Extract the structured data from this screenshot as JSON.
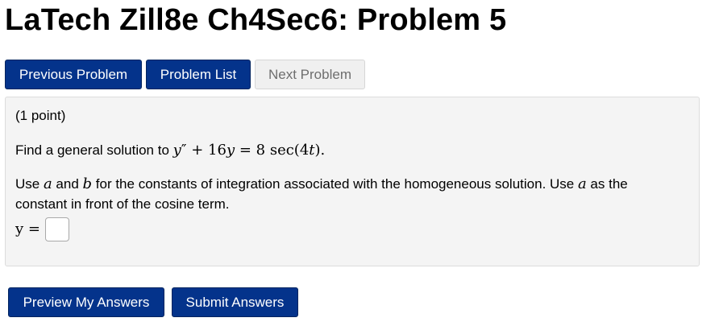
{
  "page_title": "LaTech Zill8e Ch4Sec6: Problem 5",
  "nav": {
    "previous_label": "Previous Problem",
    "list_label": "Problem List",
    "next_label": "Next Problem"
  },
  "problem": {
    "points": "(1 point)",
    "statement_prefix": "Find a general solution to ",
    "equation": {
      "y": "y",
      "prime": "″",
      "plus": " + 16",
      "y2": "y",
      "equals": " = 8 sec(4",
      "t": "t",
      "close": ")."
    },
    "instruction": {
      "part1": "Use ",
      "a": "a",
      "part2": " and ",
      "b": "b",
      "part3": " for the constants of integration associated with the homogeneous solution. Use ",
      "a2": "a",
      "part4": " as the",
      "line2": "constant in front of the cosine term."
    },
    "answer_label": "y =",
    "answer_value": ""
  },
  "actions": {
    "preview_label": "Preview My Answers",
    "submit_label": "Submit Answers"
  },
  "colors": {
    "primary_button": "#04338b",
    "disabled_button": "#f0f0f0",
    "problem_background": "#f4f4f4"
  }
}
